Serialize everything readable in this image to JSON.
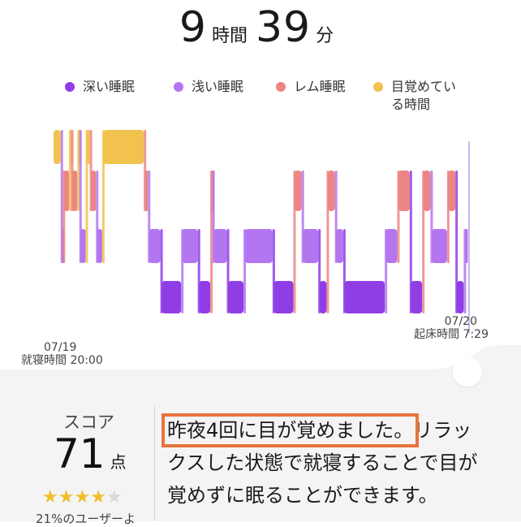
{
  "sleep": {
    "hours": "9",
    "hours_unit": "時間",
    "minutes": "39",
    "minutes_unit": "分"
  },
  "legend": [
    {
      "label": "深い睡眠",
      "color": "#8f3ee6"
    },
    {
      "label": "浅い睡眠",
      "color": "#b375f0"
    },
    {
      "label": "レム睡眠",
      "color": "#ec8584"
    },
    {
      "label": "目覚めている時間",
      "color": "#f2c24f"
    }
  ],
  "axis": {
    "start_date": "07/19",
    "start_label": "就寝時間 20:00",
    "end_date": "07/20",
    "end_label": "起床時間 7:29"
  },
  "chart_data": {
    "type": "hypnogram",
    "stage_order": [
      "目覚めている時間",
      "レム睡眠",
      "浅い睡眠",
      "深い睡眠"
    ],
    "x_range": [
      "20:00",
      "7:29"
    ],
    "segments": [
      [
        "目覚めている時間",
        0.0,
        0.02
      ],
      [
        "浅い睡眠",
        0.02,
        0.025
      ],
      [
        "レム睡眠",
        0.025,
        0.04
      ],
      [
        "目覚めている時間",
        0.04,
        0.045
      ],
      [
        "レム睡眠",
        0.045,
        0.06
      ],
      [
        "目覚めている時間",
        0.06,
        0.065
      ],
      [
        "浅い睡眠",
        0.065,
        0.08
      ],
      [
        "目覚めている時間",
        0.08,
        0.09
      ],
      [
        "レム睡眠",
        0.09,
        0.105
      ],
      [
        "浅い睡眠",
        0.105,
        0.12
      ],
      [
        "目覚めている時間",
        0.12,
        0.22
      ],
      [
        "レム睡眠",
        0.22,
        0.23
      ],
      [
        "浅い睡眠",
        0.23,
        0.26
      ],
      [
        "深い睡眠",
        0.26,
        0.31
      ],
      [
        "浅い睡眠",
        0.31,
        0.35
      ],
      [
        "深い睡眠",
        0.35,
        0.38
      ],
      [
        "レム睡眠",
        0.38,
        0.385
      ],
      [
        "浅い睡眠",
        0.385,
        0.42
      ],
      [
        "深い睡眠",
        0.42,
        0.46
      ],
      [
        "浅い睡眠",
        0.46,
        0.53
      ],
      [
        "深い睡眠",
        0.53,
        0.58
      ],
      [
        "レム睡眠",
        0.58,
        0.6
      ],
      [
        "浅い睡眠",
        0.6,
        0.64
      ],
      [
        "深い睡眠",
        0.64,
        0.66
      ],
      [
        "レム睡眠",
        0.66,
        0.68
      ],
      [
        "浅い睡眠",
        0.68,
        0.7
      ],
      [
        "深い睡眠",
        0.7,
        0.8
      ],
      [
        "浅い睡眠",
        0.8,
        0.83
      ],
      [
        "レム睡眠",
        0.83,
        0.86
      ],
      [
        "深い睡眠",
        0.86,
        0.89
      ],
      [
        "レム睡眠",
        0.89,
        0.91
      ],
      [
        "浅い睡眠",
        0.91,
        0.95
      ],
      [
        "レム睡眠",
        0.95,
        0.97
      ],
      [
        "深い睡眠",
        0.97,
        0.99
      ],
      [
        "浅い睡眠",
        0.99,
        1.0
      ]
    ]
  },
  "score": {
    "label": "スコア",
    "value": "71",
    "unit": "点",
    "stars": 4,
    "max_stars": 5,
    "percentile_text": "21%のユーザーよ"
  },
  "message": {
    "highlight": "昨夜4回に目が覚めました。",
    "rest": "リラックスした状態で就寝することで目が覚めずに眠ることができます。"
  }
}
